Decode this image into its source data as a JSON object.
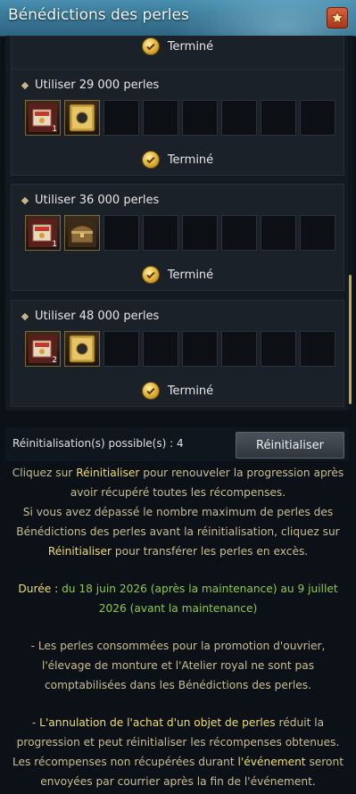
{
  "window": {
    "title": "Bénédictions des perles"
  },
  "rewards": {
    "done_label": "Terminé",
    "tiers": [
      {
        "label": "Utiliser 29 000 perles",
        "items": [
          "scroll-item-icon",
          "gold-coin-card-icon"
        ],
        "item_badges": [
          "1",
          ""
        ],
        "status": "Terminé"
      },
      {
        "label": "Utiliser 36 000 perles",
        "items": [
          "scroll-item-icon",
          "treasure-chest-icon"
        ],
        "item_badges": [
          "1",
          ""
        ],
        "status": "Terminé"
      },
      {
        "label": "Utiliser 48 000 perles",
        "items": [
          "scroll-item-icon",
          "gold-coin-card-icon"
        ],
        "item_badges": [
          "2",
          ""
        ],
        "status": "Terminé"
      }
    ],
    "empty_slots_per_tier": 6
  },
  "reset": {
    "count_label": "Réinitialisation(s) possible(s) : 4",
    "button_label": "Réinitialiser"
  },
  "info": {
    "p1_a": "Cliquez sur ",
    "p1_hl": "Réinitialiser",
    "p1_b": " pour renouveler la progression après avoir récupéré toutes les récompenses.",
    "p2_a": "Si vous avez dépassé le nombre maximum de perles des Bénédictions des perles avant la réinitialisation, cliquez sur ",
    "p2_hl": "Réinitialiser",
    "p2_b": " pour transférer les perles en excès.",
    "duration_label": "Durée : ",
    "duration_value": "du 18 juin 2026 (après la maintenance) au 9 juillet 2026 (avant la maintenance)",
    "note1": "- Les perles consommées pour la promotion d'ouvrier, l'élevage de monture et l'Atelier royal ne sont pas comptabilisées dans les Bénédictions des perles.",
    "note2_a": "- ",
    "note2_hl": "L'annulation de l'achat d'un objet de perles",
    "note2_b": " réduit la progression et peut réinitialiser les récompenses obtenues. Les récompenses non récupérées durant ",
    "note2_hl2": "l'événement",
    "note2_c": " seront envoyées par courrier après la fin de l'événement."
  },
  "colors": {
    "accent_gold": "#f2dc6a",
    "duration_green": "#8ec84a",
    "body_text": "#c9bd92",
    "title_bar": "#3a7896"
  }
}
